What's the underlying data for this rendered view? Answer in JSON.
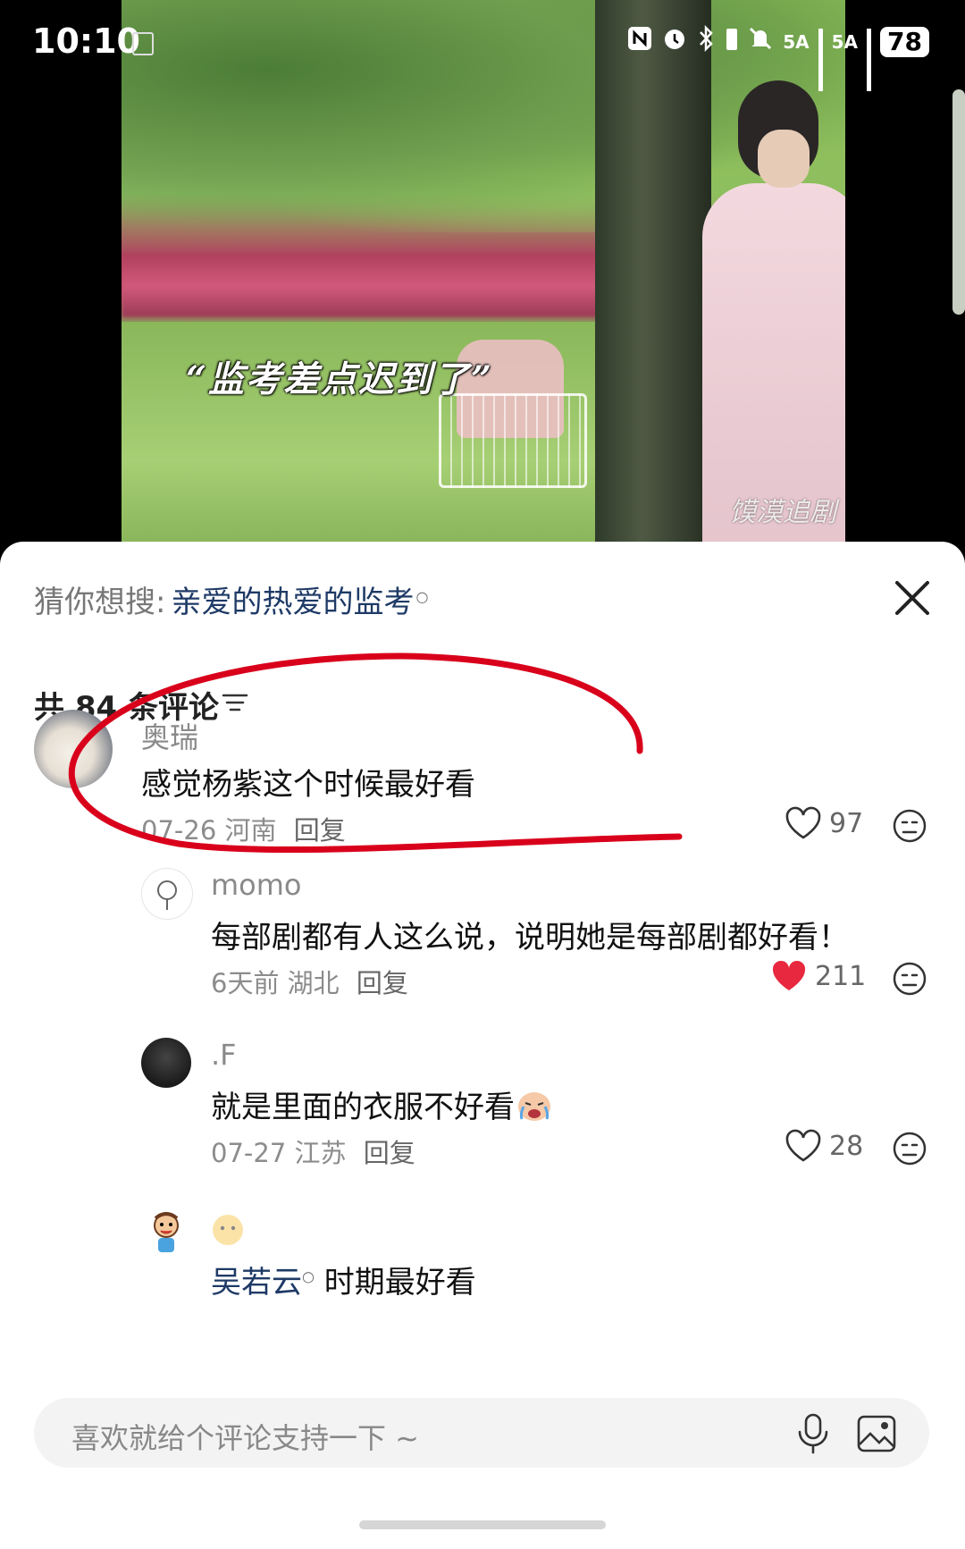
{
  "status_bar": {
    "time": "10:10",
    "network1": "5A",
    "network2": "5A",
    "battery": "78"
  },
  "video": {
    "subtitle": "“监考差点迟到了”",
    "watermark": "馍漠追剧"
  },
  "search_suggestion": {
    "label": "猜你想搜:",
    "term": "亲爱的热爱的监考"
  },
  "comments_header": {
    "count_text": "共 84 条评论"
  },
  "comments": [
    {
      "name": "奥瑞",
      "text": "感觉杨紫这个时候最好看",
      "date": "07-26",
      "location": "河南",
      "reply": "回复",
      "likes": "97",
      "liked": false
    },
    {
      "name": "momo",
      "text": "每部剧都有人这么说，说明她是每部剧都好看！",
      "date": "6天前",
      "location": "湖北",
      "reply": "回复",
      "likes": "211",
      "liked": true
    },
    {
      "name": ".F",
      "text": "就是里面的衣服不好看",
      "date": "07-27",
      "location": "江苏",
      "reply": "回复",
      "likes": "28",
      "liked": false
    },
    {
      "name": "",
      "mention": "吴若云",
      "text": "时期最好看"
    }
  ],
  "input": {
    "placeholder": "喜欢就给个评论支持一下 ~"
  },
  "colors": {
    "accent_link": "#1e3a66",
    "like_red": "#e8283f",
    "annotation_red": "#d9001b"
  }
}
